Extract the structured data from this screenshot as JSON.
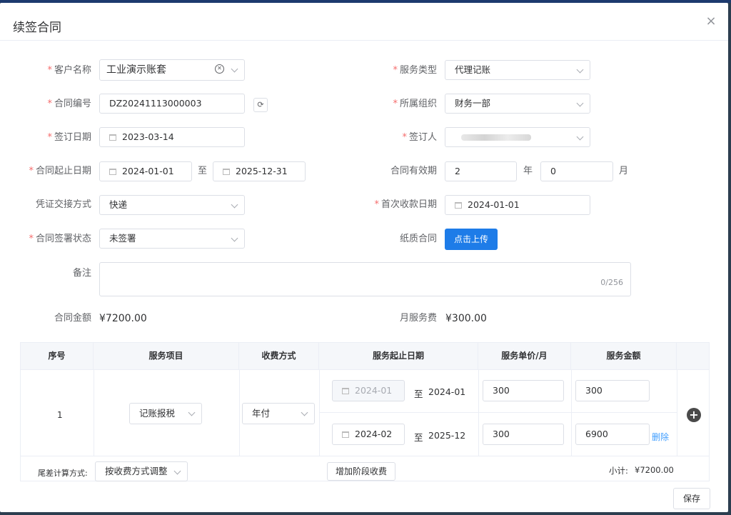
{
  "dialog": {
    "title": "续签合同",
    "close": "×"
  },
  "form": {
    "customer": {
      "label": "客户名称",
      "value": "工业演示账套"
    },
    "service_type": {
      "label": "服务类型",
      "value": "代理记账"
    },
    "contract_no": {
      "label": "合同编号",
      "value": "DZ20241113000003"
    },
    "org": {
      "label": "所属组织",
      "value": "财务一部"
    },
    "sign_date": {
      "label": "签订日期",
      "value": "2023-03-14"
    },
    "signer": {
      "label": "签订人",
      "value": ""
    },
    "period": {
      "label": "合同起止日期",
      "start": "2024-01-01",
      "sep": "至",
      "end": "2025-12-31"
    },
    "validity": {
      "label": "合同有效期",
      "years": "2",
      "year_unit": "年",
      "months": "0",
      "month_unit": "月"
    },
    "voucher": {
      "label": "凭证交接方式",
      "value": "快递"
    },
    "first_pay": {
      "label": "首次收款日期",
      "value": "2024-01-01"
    },
    "sign_status": {
      "label": "合同签署状态",
      "value": "未签署"
    },
    "paper": {
      "label": "纸质合同",
      "button": "点击上传"
    },
    "remark": {
      "label": "备注",
      "counter": "0/256"
    },
    "amount": {
      "label": "合同金额",
      "value": "¥7200.00"
    },
    "monthly_fee": {
      "label": "月服务费",
      "value": "¥300.00"
    }
  },
  "table": {
    "headers": [
      "序号",
      "服务项目",
      "收费方式",
      "服务起止日期",
      "服务单价/月",
      "服务金额"
    ],
    "row": {
      "index": "1",
      "service": "记账报税",
      "charge": "年付",
      "stages": [
        {
          "start": "2024-01",
          "sep": "至",
          "end": "2024-01",
          "price": "300",
          "amount": "300"
        },
        {
          "start": "2024-02",
          "sep": "至",
          "end": "2025-12",
          "price": "300",
          "amount": "6900",
          "delete": "删除"
        }
      ]
    },
    "footer": {
      "rounding_label": "尾差计算方式:",
      "rounding_value": "按收费方式调整",
      "add_stage": "增加阶段收费",
      "subtotal_label": "小计:",
      "subtotal_value": "¥7200.00"
    }
  },
  "actions": {
    "save": "保存"
  },
  "colors": {
    "primary": "#1e7ce8",
    "required": "#f56c6c",
    "link": "#409eff"
  }
}
